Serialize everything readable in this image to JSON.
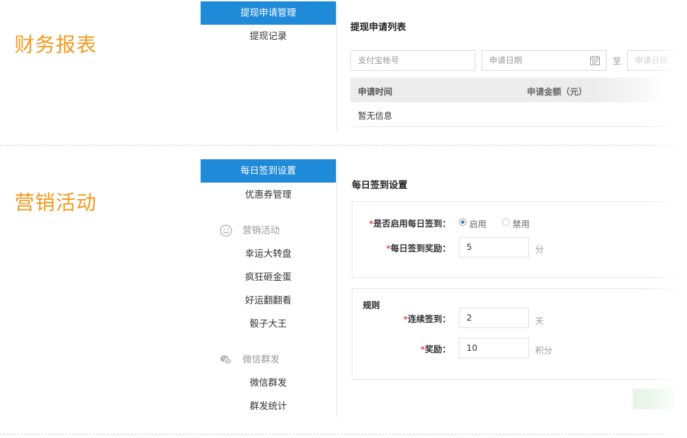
{
  "sections": {
    "finance": {
      "title": "财务报表"
    },
    "marketing": {
      "title": "营销活动"
    }
  },
  "finance_nav": {
    "items": [
      {
        "label": "提现申请管理",
        "active": true
      },
      {
        "label": "提现记录",
        "active": false
      }
    ]
  },
  "finance_panel": {
    "title": "提现申请列表",
    "filters": {
      "alipay_placeholder": "支付宝帐号",
      "date_placeholder": "申请日期",
      "range_sep": "至",
      "date_end_placeholder": "申请日期"
    },
    "table": {
      "columns": [
        "申请时间",
        "申请金额（元）"
      ],
      "empty_text": "暂无信息"
    }
  },
  "marketing_nav": {
    "items": [
      {
        "label": "每日签到设置",
        "active": true
      },
      {
        "label": "优惠券管理",
        "active": false
      }
    ],
    "groups": [
      {
        "label": "营销活动",
        "icon": "smiley-icon",
        "items": [
          "幸运大转盘",
          "疯狂砸金蛋",
          "好运翻翻看",
          "骰子大王"
        ]
      },
      {
        "label": "微信群发",
        "icon": "wechat-icon",
        "items": [
          "微信群发",
          "群发统计"
        ]
      }
    ]
  },
  "signin_panel": {
    "title": "每日签到设置",
    "enable": {
      "label": "是否启用每日签到：",
      "options": [
        "启用",
        "禁用"
      ],
      "selected": "启用"
    },
    "reward": {
      "label": "每日签到奖励：",
      "value": "5",
      "unit": "分"
    },
    "rules": {
      "title": "规则",
      "consecutive": {
        "label": "连续签到：",
        "value": "2",
        "unit": "天"
      },
      "bonus": {
        "label": "奖励：",
        "value": "10",
        "unit": "积分"
      }
    },
    "required_mark": "*"
  },
  "colors": {
    "accent": "#1f8ad8",
    "section_title": "#f49a20",
    "required": "#d9534f",
    "save_button": "#e8f5e9"
  }
}
